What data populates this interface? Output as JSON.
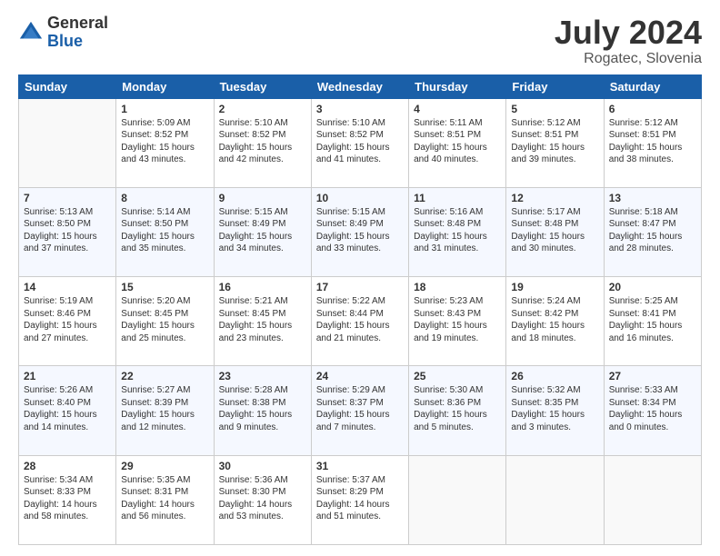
{
  "logo": {
    "general": "General",
    "blue": "Blue"
  },
  "title": "July 2024",
  "location": "Rogatec, Slovenia",
  "weekdays": [
    "Sunday",
    "Monday",
    "Tuesday",
    "Wednesday",
    "Thursday",
    "Friday",
    "Saturday"
  ],
  "weeks": [
    [
      {
        "day": "",
        "sunrise": "",
        "sunset": "",
        "daylight": ""
      },
      {
        "day": "1",
        "sunrise": "Sunrise: 5:09 AM",
        "sunset": "Sunset: 8:52 PM",
        "daylight": "Daylight: 15 hours and 43 minutes."
      },
      {
        "day": "2",
        "sunrise": "Sunrise: 5:10 AM",
        "sunset": "Sunset: 8:52 PM",
        "daylight": "Daylight: 15 hours and 42 minutes."
      },
      {
        "day": "3",
        "sunrise": "Sunrise: 5:10 AM",
        "sunset": "Sunset: 8:52 PM",
        "daylight": "Daylight: 15 hours and 41 minutes."
      },
      {
        "day": "4",
        "sunrise": "Sunrise: 5:11 AM",
        "sunset": "Sunset: 8:51 PM",
        "daylight": "Daylight: 15 hours and 40 minutes."
      },
      {
        "day": "5",
        "sunrise": "Sunrise: 5:12 AM",
        "sunset": "Sunset: 8:51 PM",
        "daylight": "Daylight: 15 hours and 39 minutes."
      },
      {
        "day": "6",
        "sunrise": "Sunrise: 5:12 AM",
        "sunset": "Sunset: 8:51 PM",
        "daylight": "Daylight: 15 hours and 38 minutes."
      }
    ],
    [
      {
        "day": "7",
        "sunrise": "Sunrise: 5:13 AM",
        "sunset": "Sunset: 8:50 PM",
        "daylight": "Daylight: 15 hours and 37 minutes."
      },
      {
        "day": "8",
        "sunrise": "Sunrise: 5:14 AM",
        "sunset": "Sunset: 8:50 PM",
        "daylight": "Daylight: 15 hours and 35 minutes."
      },
      {
        "day": "9",
        "sunrise": "Sunrise: 5:15 AM",
        "sunset": "Sunset: 8:49 PM",
        "daylight": "Daylight: 15 hours and 34 minutes."
      },
      {
        "day": "10",
        "sunrise": "Sunrise: 5:15 AM",
        "sunset": "Sunset: 8:49 PM",
        "daylight": "Daylight: 15 hours and 33 minutes."
      },
      {
        "day": "11",
        "sunrise": "Sunrise: 5:16 AM",
        "sunset": "Sunset: 8:48 PM",
        "daylight": "Daylight: 15 hours and 31 minutes."
      },
      {
        "day": "12",
        "sunrise": "Sunrise: 5:17 AM",
        "sunset": "Sunset: 8:48 PM",
        "daylight": "Daylight: 15 hours and 30 minutes."
      },
      {
        "day": "13",
        "sunrise": "Sunrise: 5:18 AM",
        "sunset": "Sunset: 8:47 PM",
        "daylight": "Daylight: 15 hours and 28 minutes."
      }
    ],
    [
      {
        "day": "14",
        "sunrise": "Sunrise: 5:19 AM",
        "sunset": "Sunset: 8:46 PM",
        "daylight": "Daylight: 15 hours and 27 minutes."
      },
      {
        "day": "15",
        "sunrise": "Sunrise: 5:20 AM",
        "sunset": "Sunset: 8:45 PM",
        "daylight": "Daylight: 15 hours and 25 minutes."
      },
      {
        "day": "16",
        "sunrise": "Sunrise: 5:21 AM",
        "sunset": "Sunset: 8:45 PM",
        "daylight": "Daylight: 15 hours and 23 minutes."
      },
      {
        "day": "17",
        "sunrise": "Sunrise: 5:22 AM",
        "sunset": "Sunset: 8:44 PM",
        "daylight": "Daylight: 15 hours and 21 minutes."
      },
      {
        "day": "18",
        "sunrise": "Sunrise: 5:23 AM",
        "sunset": "Sunset: 8:43 PM",
        "daylight": "Daylight: 15 hours and 19 minutes."
      },
      {
        "day": "19",
        "sunrise": "Sunrise: 5:24 AM",
        "sunset": "Sunset: 8:42 PM",
        "daylight": "Daylight: 15 hours and 18 minutes."
      },
      {
        "day": "20",
        "sunrise": "Sunrise: 5:25 AM",
        "sunset": "Sunset: 8:41 PM",
        "daylight": "Daylight: 15 hours and 16 minutes."
      }
    ],
    [
      {
        "day": "21",
        "sunrise": "Sunrise: 5:26 AM",
        "sunset": "Sunset: 8:40 PM",
        "daylight": "Daylight: 15 hours and 14 minutes."
      },
      {
        "day": "22",
        "sunrise": "Sunrise: 5:27 AM",
        "sunset": "Sunset: 8:39 PM",
        "daylight": "Daylight: 15 hours and 12 minutes."
      },
      {
        "day": "23",
        "sunrise": "Sunrise: 5:28 AM",
        "sunset": "Sunset: 8:38 PM",
        "daylight": "Daylight: 15 hours and 9 minutes."
      },
      {
        "day": "24",
        "sunrise": "Sunrise: 5:29 AM",
        "sunset": "Sunset: 8:37 PM",
        "daylight": "Daylight: 15 hours and 7 minutes."
      },
      {
        "day": "25",
        "sunrise": "Sunrise: 5:30 AM",
        "sunset": "Sunset: 8:36 PM",
        "daylight": "Daylight: 15 hours and 5 minutes."
      },
      {
        "day": "26",
        "sunrise": "Sunrise: 5:32 AM",
        "sunset": "Sunset: 8:35 PM",
        "daylight": "Daylight: 15 hours and 3 minutes."
      },
      {
        "day": "27",
        "sunrise": "Sunrise: 5:33 AM",
        "sunset": "Sunset: 8:34 PM",
        "daylight": "Daylight: 15 hours and 0 minutes."
      }
    ],
    [
      {
        "day": "28",
        "sunrise": "Sunrise: 5:34 AM",
        "sunset": "Sunset: 8:33 PM",
        "daylight": "Daylight: 14 hours and 58 minutes."
      },
      {
        "day": "29",
        "sunrise": "Sunrise: 5:35 AM",
        "sunset": "Sunset: 8:31 PM",
        "daylight": "Daylight: 14 hours and 56 minutes."
      },
      {
        "day": "30",
        "sunrise": "Sunrise: 5:36 AM",
        "sunset": "Sunset: 8:30 PM",
        "daylight": "Daylight: 14 hours and 53 minutes."
      },
      {
        "day": "31",
        "sunrise": "Sunrise: 5:37 AM",
        "sunset": "Sunset: 8:29 PM",
        "daylight": "Daylight: 14 hours and 51 minutes."
      },
      {
        "day": "",
        "sunrise": "",
        "sunset": "",
        "daylight": ""
      },
      {
        "day": "",
        "sunrise": "",
        "sunset": "",
        "daylight": ""
      },
      {
        "day": "",
        "sunrise": "",
        "sunset": "",
        "daylight": ""
      }
    ]
  ]
}
